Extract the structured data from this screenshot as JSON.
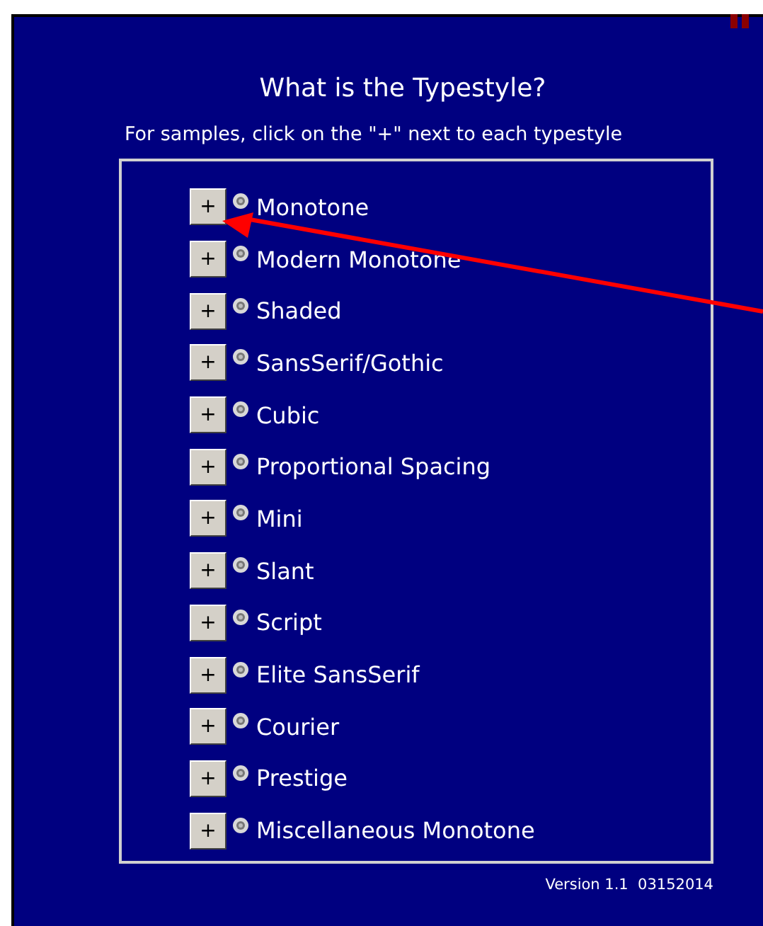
{
  "title": "What is the Typestyle?",
  "instructions": "For samples, click on the \"+\" next to each typestyle",
  "typestyles": [
    {
      "expand_label": "+",
      "name": "Monotone"
    },
    {
      "expand_label": "+",
      "name": "Modern Monotone"
    },
    {
      "expand_label": "+",
      "name": "Shaded"
    },
    {
      "expand_label": "+",
      "name": "SansSerif/Gothic"
    },
    {
      "expand_label": "+",
      "name": "Cubic"
    },
    {
      "expand_label": "+",
      "name": "Proportional Spacing"
    },
    {
      "expand_label": "+",
      "name": "Mini"
    },
    {
      "expand_label": "+",
      "name": "Slant"
    },
    {
      "expand_label": "+",
      "name": "Script"
    },
    {
      "expand_label": "+",
      "name": "Elite SansSerif"
    },
    {
      "expand_label": "+",
      "name": "Courier"
    },
    {
      "expand_label": "+",
      "name": "Prestige"
    },
    {
      "expand_label": "+",
      "name": "Miscellaneous Monotone"
    }
  ],
  "version": "Version 1.1  03152014"
}
